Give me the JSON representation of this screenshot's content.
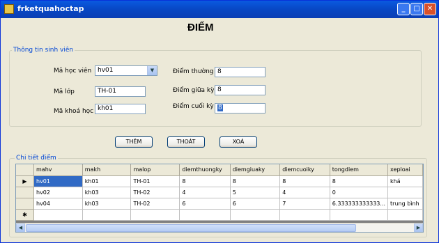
{
  "window": {
    "title": "frketquahoctap"
  },
  "heading": "ĐIỂM",
  "student_group": {
    "legend": "Thông tin sinh viên",
    "ma_hoc_vien_label": "Mã học viên",
    "ma_hoc_vien_value": "hv01",
    "ma_lop_label": "Mã lớp",
    "ma_lop_value": "TH-01",
    "ma_khoa_hoc_label": "Mã khoá học",
    "ma_khoa_hoc_value": "kh01",
    "diem_thuong_ky_label": "Điểm thường kỳ",
    "diem_thuong_ky_value": "8",
    "diem_giua_ky_label": "Điểm giữa kỳ",
    "diem_giua_ky_value": "8",
    "diem_cuoi_ky_label": "Điểm cuối kỳ",
    "diem_cuoi_ky_value": "8"
  },
  "buttons": {
    "them": "THÊM",
    "thoat": "THOÁT",
    "xoa": "XOÁ"
  },
  "detail_group": {
    "legend": "Chi tiết điểm",
    "columns": [
      "mahv",
      "makh",
      "malop",
      "diemthuongky",
      "diemgiuaky",
      "diemcuoiky",
      "tongdiem",
      "xeploai"
    ],
    "rows": [
      [
        "hv01",
        "kh01",
        "TH-01",
        "8",
        "8",
        "8",
        "8",
        "khá"
      ],
      [
        "hv02",
        "kh03",
        "TH-02",
        "4",
        "5",
        "4",
        "0",
        ""
      ],
      [
        "hv04",
        "kh03",
        "TH-02",
        "6",
        "6",
        "7",
        "6.333333333333...",
        "trung bình"
      ]
    ],
    "current_row_marker": "▶",
    "new_row_marker": "✱"
  },
  "colors": {
    "titlebar": "#0847c4",
    "selection": "#316ac5",
    "group_legend": "#0046d5"
  }
}
